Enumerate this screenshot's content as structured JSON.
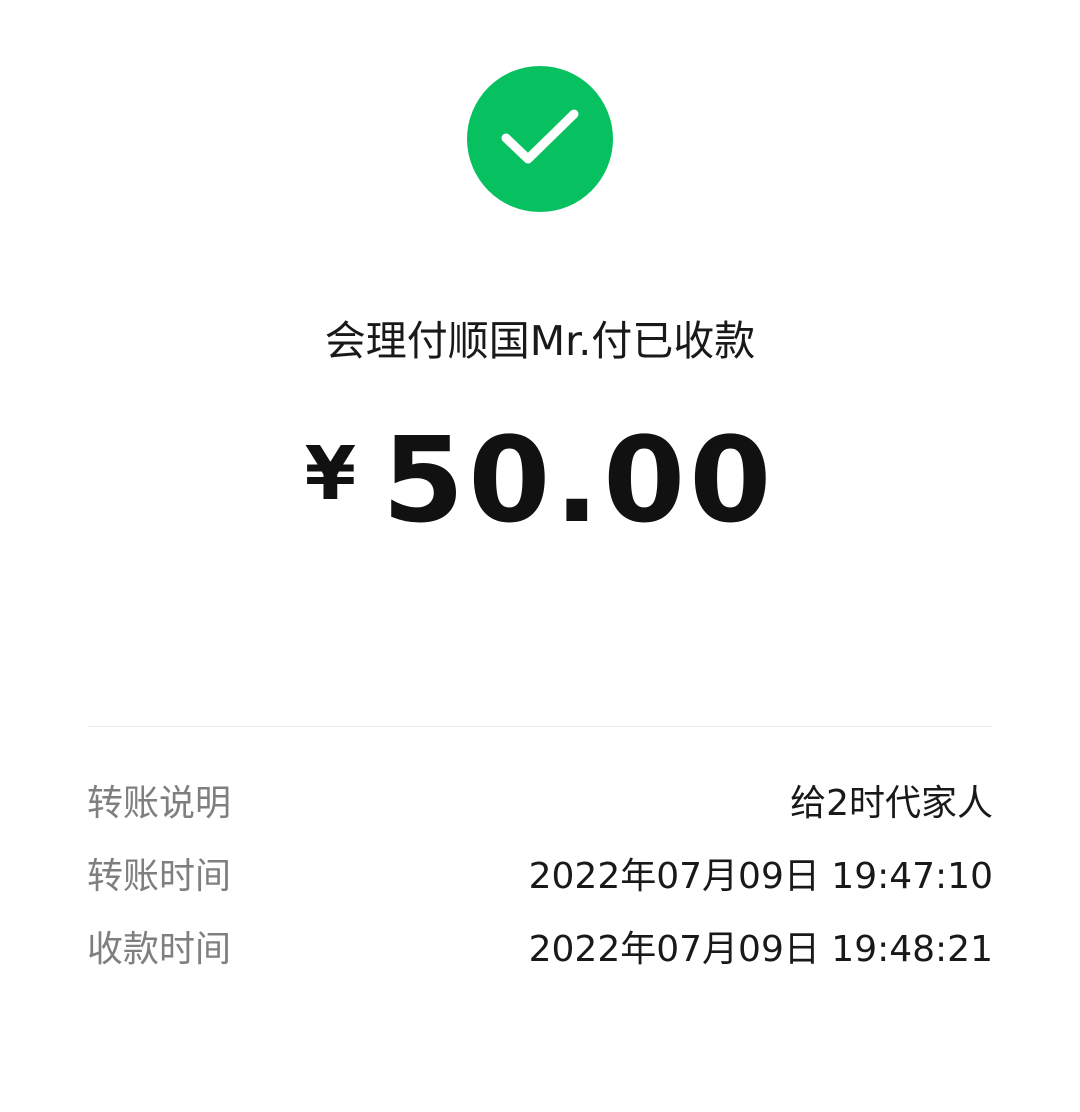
{
  "status": {
    "icon": "check-circle-icon",
    "color": "#07c160",
    "text": "会理付顺国Mr.付已收款"
  },
  "amount": {
    "currency": "¥",
    "value": "50.00"
  },
  "details": [
    {
      "label": "转账说明",
      "value": "给2时代家人"
    },
    {
      "label": "转账时间",
      "value": "2022年07月09日 19:47:10"
    },
    {
      "label": "收款时间",
      "value": "2022年07月09日 19:48:21"
    }
  ]
}
